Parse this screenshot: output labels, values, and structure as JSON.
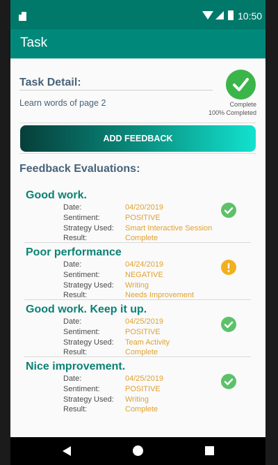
{
  "status_bar": {
    "time": "10:50"
  },
  "app_bar": {
    "title": "Task"
  },
  "task": {
    "label": "Task Detail:",
    "description": "Learn words of page 2",
    "status": "Complete",
    "percent": "100% Completed"
  },
  "feedback_button": {
    "label": "ADD FEEDBACK"
  },
  "evaluations_heading": "Feedback Evaluations:",
  "field_labels": {
    "date": "Date:",
    "sentiment": "Sentiment:",
    "strategy": "Strategy Used:",
    "result": "Result:"
  },
  "evaluations": [
    {
      "heading": "Good work.",
      "date": "04/20/2019",
      "sentiment": "POSITIVE",
      "strategy": "Smart Interactive Session",
      "result": "Complete",
      "icon": "check-circle-icon"
    },
    {
      "heading": "Poor performance",
      "date": "04/24/2019",
      "sentiment": "NEGATIVE",
      "strategy": "Writing",
      "result": "Needs Improvement",
      "icon": "warning-circle-icon"
    },
    {
      "heading": "Good work. Keep it up.",
      "date": "04/25/2019",
      "sentiment": "POSITIVE",
      "strategy": "Team Activity",
      "result": "Complete",
      "icon": "check-circle-icon"
    },
    {
      "heading": "Nice improvement.",
      "date": "04/25/2019",
      "sentiment": "POSITIVE",
      "strategy": "Writing",
      "result": "Complete",
      "icon": "check-circle-icon"
    }
  ],
  "colors": {
    "primary": "#00897b",
    "primary_dark": "#00796b",
    "heading_teal": "#0a8275",
    "value_orange": "#e0a130",
    "success_green": "#5dc16a",
    "warning_yellow": "#f2b01e"
  }
}
